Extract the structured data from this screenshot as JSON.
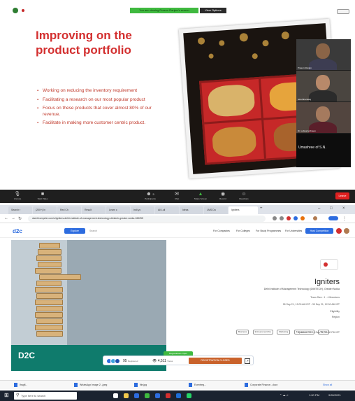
{
  "zoom": {
    "share_banner": "You are viewing Prasun Ranjan's screen",
    "view_options": "View Options",
    "slide": {
      "title": "Improving on the product portfolio",
      "bullets": [
        "Working on reducing the inventory requirement",
        "Facilitating a research on our most popular product",
        "Focus on these products that cover almost 80% of our revenue.",
        "Facilitate in making more customer centric product."
      ]
    },
    "participants": [
      {
        "name": "Prasun Ranjan"
      },
      {
        "name": "Isha Bhardwaj"
      },
      {
        "name": "Dr. Lubna Ambreen"
      }
    ],
    "speaking_label": "Umashree of S.N.",
    "toolbar": [
      {
        "icon": "microphone-icon",
        "label": "Unmute"
      },
      {
        "icon": "video-icon",
        "label": "Start Video"
      },
      {
        "icon": "participants-icon",
        "label": "Participants",
        "count": "5"
      },
      {
        "icon": "chat-icon",
        "label": "Chat"
      },
      {
        "icon": "share-icon",
        "label": "Share Screen"
      },
      {
        "icon": "record-icon",
        "label": "Record"
      },
      {
        "icon": "reactions-icon",
        "label": "Reactions"
      }
    ],
    "end_label": "Leave"
  },
  "browser": {
    "tabs": [
      "Search r",
      "(200+) In",
      "Red Ch",
      "Result",
      "Learn c",
      "Indi yo",
      "Ali Luli",
      "Ideas",
      "LMS Da",
      "Igniters"
    ],
    "url": "dare2compete.com/o/igniters-delhi-institute-of-management-technology-dimtech-greater-noida-165255",
    "header": {
      "logo": "d2c",
      "explore": "Explore",
      "search_placeholder": "Search",
      "nav": [
        "For Companies",
        "For Colleges",
        "For Study Programmes",
        "For Universities"
      ],
      "host_button": "Host Competition"
    },
    "hero_logo_text": "D2C",
    "event": {
      "name": "Igniters",
      "org": "Delhi Institute of Management Technology (DIMTECH), Greater Noida",
      "team_size": "Team Size : 1 - 4 Members",
      "dates": "26 Sep 21, 12:00 AM IST - 30 Sep 21, 12:00 AM IST",
      "eligibility": "Eligibility",
      "region": "Region",
      "tags": [
        "Business",
        "Entrepreneurship",
        "Marketing",
        "Entrepreneurship",
        "Startup"
      ],
      "updated": "Updated On: 15 Sep 21, 03:00 PM IST"
    },
    "registration": {
      "badge": "Registrations Open",
      "registered_count": "95",
      "registered_label": "Registered",
      "views_count": "4,511",
      "views_label": "Views",
      "button": "REGISTRATION CLOSED"
    },
    "downloads": [
      "Ihsgfl...",
      "WhatsApp Image 2...jpeg",
      "file.jpg",
      "Eventreg...",
      "Corporate Finance...docx"
    ],
    "show_all": "Show all",
    "taskbar": {
      "search_placeholder": "Type here to search",
      "time": "1:00 PM",
      "date": "9/26/2021"
    }
  }
}
